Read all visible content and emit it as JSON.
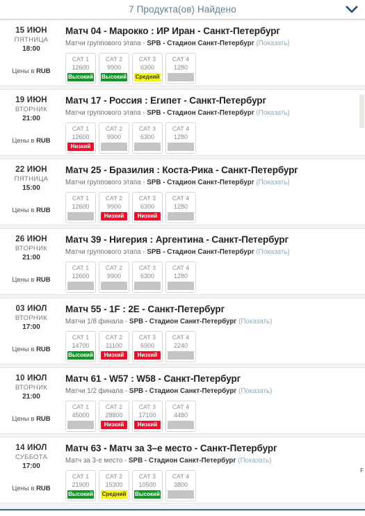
{
  "header": {
    "title": "7 Продукта(ов) Найдено",
    "toggle_icon": "chevron-down-icon"
  },
  "labels": {
    "currency_prefix": "Цены в ",
    "currency": "RUB",
    "show_link": "(Показать)",
    "venue_code": "SPB",
    "venue_name": "Стадион Санкт-Петербург",
    "dash": " - "
  },
  "availability_text": {
    "high": "Высокий",
    "medium": "Средний",
    "low": "Низкий",
    "none": ""
  },
  "colors": {
    "high": "#119524",
    "medium": "#f7f21a",
    "low": "#e8112d",
    "none": "#c4c4c4",
    "header_text": "#5c7f9c",
    "link": "#8fa9bb",
    "bottom_rule": "#2f6d78"
  },
  "edge_fragment": "F",
  "events": [
    {
      "date_day": "15 ИЮН",
      "date_weekday": "ПЯТНИЦА",
      "date_time": "18:00",
      "title": "Матч 04 - Марокко : ИР Иран - Санкт-Петербург",
      "stage": "Матчи группового этапа",
      "venue_code": "SPB",
      "venue_name": "Стадион Санкт-Петербург",
      "show_link": "(Показать)",
      "currency_label": "Цены в ",
      "currency": "RUB",
      "prices": [
        {
          "cat": "CAT 1",
          "value": "12600",
          "availability": "high",
          "avail_label": "Высокий"
        },
        {
          "cat": "CAT 2",
          "value": "9900",
          "availability": "high",
          "avail_label": "Высокий"
        },
        {
          "cat": "CAT 3",
          "value": "6300",
          "availability": "medium",
          "avail_label": "Средний"
        },
        {
          "cat": "CAT 4",
          "value": "1280",
          "availability": "none",
          "avail_label": ""
        }
      ]
    },
    {
      "date_day": "19 ИЮН",
      "date_weekday": "ВТОРНИК",
      "date_time": "21:00",
      "title": "Матч 17 - Россия : Египет - Санкт-Петербург",
      "stage": "Матчи группового этапа",
      "venue_code": "SPB",
      "venue_name": "Стадион Санкт-Петербург",
      "show_link": "(Показать)",
      "currency_label": "Цены в ",
      "currency": "RUB",
      "prices": [
        {
          "cat": "CAT 1",
          "value": "12600",
          "availability": "low",
          "avail_label": "Низкий"
        },
        {
          "cat": "CAT 2",
          "value": "9900",
          "availability": "none",
          "avail_label": ""
        },
        {
          "cat": "CAT 3",
          "value": "6300",
          "availability": "none",
          "avail_label": ""
        },
        {
          "cat": "CAT 4",
          "value": "1280",
          "availability": "none",
          "avail_label": ""
        }
      ]
    },
    {
      "date_day": "22 ИЮН",
      "date_weekday": "ПЯТНИЦА",
      "date_time": "15:00",
      "title": "Матч 25 - Бразилия : Коста-Рика - Санкт-Петербург",
      "stage": "Матчи группового этапа",
      "venue_code": "SPB",
      "venue_name": "Стадион Санкт-Петербург",
      "show_link": "(Показать)",
      "currency_label": "Цены в ",
      "currency": "RUB",
      "prices": [
        {
          "cat": "CAT 1",
          "value": "12600",
          "availability": "none",
          "avail_label": ""
        },
        {
          "cat": "CAT 2",
          "value": "9900",
          "availability": "low",
          "avail_label": "Низкий"
        },
        {
          "cat": "CAT 3",
          "value": "6300",
          "availability": "low",
          "avail_label": "Низкий"
        },
        {
          "cat": "CAT 4",
          "value": "1280",
          "availability": "none",
          "avail_label": ""
        }
      ]
    },
    {
      "date_day": "26 ИЮН",
      "date_weekday": "ВТОРНИК",
      "date_time": "21:00",
      "title": "Матч 39 - Нигерия : Аргентина - Санкт-Петербург",
      "stage": "Матчи группового этапа",
      "venue_code": "SPB",
      "venue_name": "Стадион Санкт-Петербург",
      "show_link": "(Показать)",
      "currency_label": "Цены в ",
      "currency": "RUB",
      "prices": [
        {
          "cat": "CAT 1",
          "value": "12600",
          "availability": "none",
          "avail_label": ""
        },
        {
          "cat": "CAT 2",
          "value": "9900",
          "availability": "none",
          "avail_label": ""
        },
        {
          "cat": "CAT 3",
          "value": "6300",
          "availability": "none",
          "avail_label": ""
        },
        {
          "cat": "CAT 4",
          "value": "1280",
          "availability": "none",
          "avail_label": ""
        }
      ]
    },
    {
      "date_day": "03 ИЮЛ",
      "date_weekday": "ВТОРНИК",
      "date_time": "17:00",
      "title": "Матч 55 - 1F : 2E - Санкт-Петербург",
      "stage": "Матчи 1/8 финала",
      "venue_code": "SPB",
      "venue_name": "Стадион Санкт-Петербург",
      "show_link": "(Показать)",
      "currency_label": "Цены в ",
      "currency": "RUB",
      "prices": [
        {
          "cat": "CAT 1",
          "value": "14700",
          "availability": "high",
          "avail_label": "Высокий"
        },
        {
          "cat": "CAT 2",
          "value": "11100",
          "availability": "low",
          "avail_label": "Низкий"
        },
        {
          "cat": "CAT 3",
          "value": "6900",
          "availability": "low",
          "avail_label": "Низкий"
        },
        {
          "cat": "CAT 4",
          "value": "2240",
          "availability": "none",
          "avail_label": ""
        }
      ]
    },
    {
      "date_day": "10 ИЮЛ",
      "date_weekday": "ВТОРНИК",
      "date_time": "21:00",
      "title": "Матч 61 - W57 : W58 - Санкт-Петербург",
      "stage": "Матчи 1/2 финала",
      "venue_code": "SPB",
      "venue_name": "Стадион Санкт-Петербург",
      "show_link": "(Показать)",
      "currency_label": "Цены в ",
      "currency": "RUB",
      "prices": [
        {
          "cat": "CAT 1",
          "value": "45000",
          "availability": "none",
          "avail_label": ""
        },
        {
          "cat": "CAT 2",
          "value": "28800",
          "availability": "low",
          "avail_label": "Низкий"
        },
        {
          "cat": "CAT 3",
          "value": "17100",
          "availability": "low",
          "avail_label": "Низкий"
        },
        {
          "cat": "CAT 4",
          "value": "4480",
          "availability": "none",
          "avail_label": ""
        }
      ]
    },
    {
      "date_day": "14 ИЮЛ",
      "date_weekday": "СУББОТА",
      "date_time": "17:00",
      "title": "Матч 63 - Матч за 3–е место - Санкт-Петербург",
      "stage": "Матч за 3-е место",
      "venue_code": "SPB",
      "venue_name": "Стадион Санкт-Петербург",
      "show_link": "(Показать)",
      "currency_label": "Цены в ",
      "currency": "RUB",
      "prices": [
        {
          "cat": "CAT 1",
          "value": "21900",
          "availability": "high",
          "avail_label": "Высокий"
        },
        {
          "cat": "CAT 2",
          "value": "15300",
          "availability": "medium",
          "avail_label": "Средний"
        },
        {
          "cat": "CAT 3",
          "value": "10500",
          "availability": "high",
          "avail_label": "Высокий"
        },
        {
          "cat": "CAT 4",
          "value": "3800",
          "availability": "none",
          "avail_label": ""
        }
      ]
    }
  ]
}
